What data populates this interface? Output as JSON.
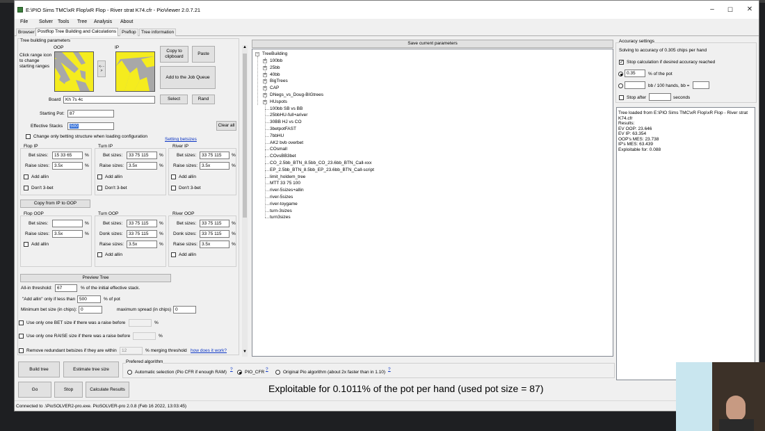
{
  "window": {
    "title": "E:\\PIO Sims TMC\\xR Flop\\xR Flop - River strat K74.cfr - PioViewer 2.0.7.21",
    "menu": [
      "File",
      "Solver",
      "Tools",
      "Tree",
      "Analysis",
      "About"
    ],
    "tabs": [
      "Browser",
      "Postflop Tree Building and Calculations",
      "Preflop",
      "Tree information"
    ],
    "active_tab": "Postflop Tree Building and Calculations"
  },
  "tree_params": {
    "group_title": "Tree building parameters",
    "click_hint": "Click range icon to change starting ranges",
    "oop_label": "OOP",
    "ip_label": "IP",
    "swap_label": "<- ->",
    "copy_clipboard": "Copy to clipboard",
    "paste": "Paste",
    "add_queue": "Add to the Job Queue",
    "board_label": "Board",
    "board_value": "Kh 7s 4c",
    "select": "Select",
    "rand": "Rand",
    "starting_pot_label": "Starting Pot:",
    "starting_pot": "87",
    "eff_stacks_label": "Effective Stacks",
    "eff_stacks": "500",
    "clear_all": "Clear all",
    "change_only_betting": "Change only betting structure when loading configuration",
    "setting_betsizes": "Setting betsizes"
  },
  "ip_streets": {
    "flop": {
      "title": "Flop IP",
      "bet_label": "Bet sizes:",
      "bet": "15 33 65",
      "raise_label": "Raise sizes:",
      "raise": "3.5x",
      "pct1": "%",
      "pct2": "%",
      "allin": "Add allin",
      "no3bet": "Don't 3-bet"
    },
    "turn": {
      "title": "Turn IP",
      "bet_label": "Bet sizes:",
      "bet": "33 75 115",
      "raise_label": "Raise sizes:",
      "raise": "3.5x",
      "pct1": "%",
      "pct2": "%",
      "allin": "Add allin",
      "no3bet": "Don't 3-bet"
    },
    "river": {
      "title": "River IP",
      "bet_label": "Bet sizes:",
      "bet": "33 75 115",
      "raise_label": "Raise sizes:",
      "raise": "3.5x",
      "pct1": "%",
      "pct2": "%",
      "allin": "Add allin",
      "no3bet": "Don't 3-bet"
    }
  },
  "copy_ip_to_oop": "Copy from IP to OOP",
  "oop_streets": {
    "flop": {
      "title": "Flop OOP",
      "bet_label": "Bet sizes:",
      "bet": "",
      "raise_label": "Raise sizes:",
      "raise": "3.5x",
      "pct1": "%",
      "pct2": "%",
      "allin": "Add allin"
    },
    "turn": {
      "title": "Turn OOP",
      "bet_label": "Bet sizes:",
      "bet": "33 75 115",
      "donk_label": "Donk sizes:",
      "donk": "33 75 115",
      "raise_label": "Raise sizes:",
      "raise": "3.5x",
      "pct1": "%",
      "pct2": "%",
      "pct3": "%",
      "allin": "Add allin"
    },
    "river": {
      "title": "River OOP",
      "bet_label": "Bet sizes:",
      "bet": "33 75 115",
      "donk_label": "Donk sizes:",
      "donk": "33 75 115",
      "raise_label": "Raise sizes:",
      "raise": "3.5x",
      "pct1": "%",
      "pct2": "%",
      "pct3": "%",
      "allin": "Add allin"
    }
  },
  "preview_tree": "Preview Tree",
  "thresholds": {
    "allin_label": "All-in threshold:",
    "allin": "67",
    "allin_suffix": "% of the initial effective stack.",
    "add_allin_label": "\"Add allin\" only if less than",
    "add_allin": "500",
    "add_allin_suffix": "% of pot",
    "min_bet_label": "Minimum bet size (in chips):",
    "min_bet": "0",
    "max_spread_label": "maximum spread (in chips)",
    "max_spread": "0",
    "one_bet": "Use only one BET size if there was a raise before",
    "one_raise": "Use only one RAISE size if there was a raise before",
    "pct": "%",
    "remove_redundant": "Remove redundant betsizes if they are within",
    "redundant_value": "12",
    "merging": "% merging threshold",
    "how_does": "how does it work?"
  },
  "bottom_buttons": {
    "build_tree": "Build tree",
    "estimate": "Estimate tree size",
    "go": "Go",
    "stop": "Stop",
    "calculate": "Calculate Results"
  },
  "algorithm": {
    "title": "Prefered algorithm",
    "auto": "Automatic selection (Pio CFR if enough RAM)",
    "pio_cfr": "PIO_CFR",
    "original": "Original Pio algorithm (about 2x faster than in 1.10)",
    "q": "?"
  },
  "exploitable_banner": "Exploitable for 0.1011% of the pot per hand (used pot size = 87)",
  "status_bar": "Connected to .\\PioSOLVER2-pro.exe. PioSOLVER-pro 2.0.8 (Feb 16 2022, 13:03:45)",
  "save_params": "Save current parameters",
  "tree": {
    "root": "TreeBuilding",
    "folders": [
      "100bb",
      "25bb",
      "40bb",
      "BigTrees",
      "CAP",
      "DNegs_vs_Doug-BIGtrees",
      "HUspots"
    ],
    "files": [
      "100bb SB vs BB",
      "25bbHU-full+ariver",
      "30BB HJ vs CO",
      "3betpotFAST",
      "7bbHU",
      "AK2 bvb overbet",
      "COsmall",
      "COvsBB3bet",
      "CO_2.5bb_BTN_8.5bb_CO_23.6bb_BTN_Call-xxx",
      "EP_2.5bb_BTN_8.5bb_EP_23.6bb_BTN_Call-script",
      "limit_holdem_tree",
      "MTT 33 75 100",
      "river-5sizes+allin",
      "river-5sizes",
      "river-toygame",
      "turn-3sizes",
      "turn3sizes"
    ]
  },
  "accuracy": {
    "group_title": "Accuracy settings",
    "solving_to": "Solving to accuracy of 0.305 chips per hand",
    "stop_calc": "Stop calculation if desired accuracy reached",
    "pct_value": "0.35",
    "pct_suffix": "% of the pot",
    "bb_suffix": "bb / 100 hands, bb =",
    "stop_after": "Stop after",
    "seconds": "seconds",
    "log": [
      "Tree loaded from E:\\PIO Sims TMC\\xR Flop\\xR Flop - River strat K74.cfr",
      "Results:",
      "EV OOP: 23.646",
      "EV IP: 63.354",
      "OOP's MES: 23.738",
      "IP's MES: 63.439",
      "Exploitable for: 0.088"
    ]
  },
  "colors": {
    "range_yellow": "#f5ec1e",
    "range_gray": "#a8a8a8",
    "link": "#0a34c4"
  }
}
